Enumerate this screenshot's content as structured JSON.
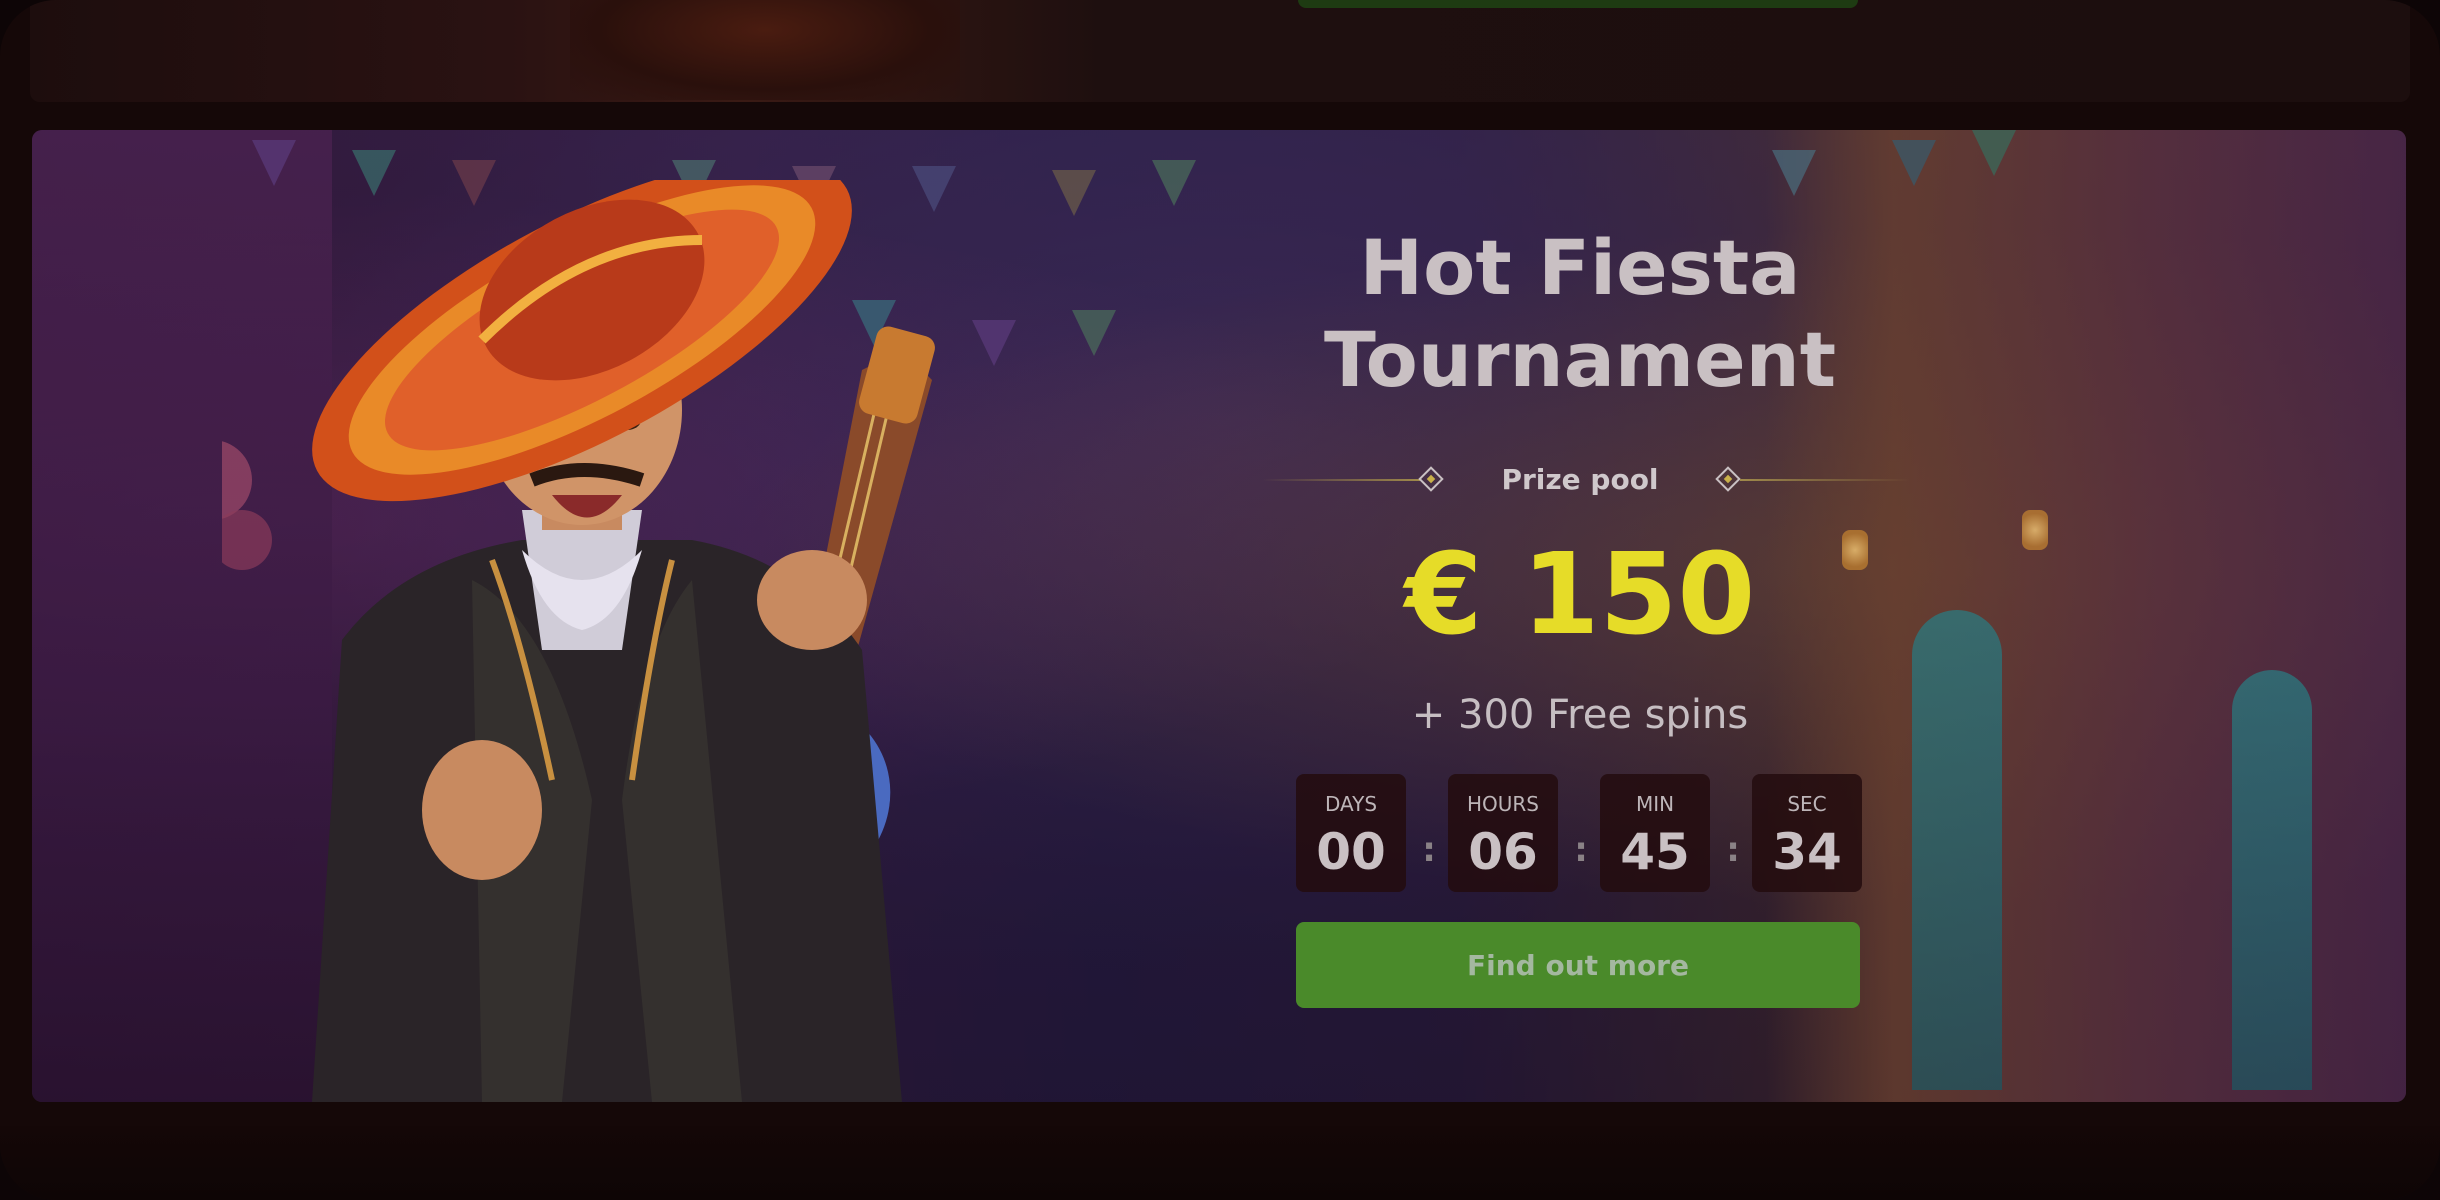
{
  "banner": {
    "title_line1": "Hot Fiesta",
    "title_line2": "Tournament",
    "prize_label": "Prize pool",
    "prize_amount": "€ 150",
    "free_spins": "+ 300 Free spins",
    "countdown": [
      {
        "label": "DAYS",
        "value": "00"
      },
      {
        "label": "HOURS",
        "value": "06"
      },
      {
        "label": "MIN",
        "value": "45"
      },
      {
        "label": "SEC",
        "value": "34"
      }
    ],
    "separator": ":",
    "cta_label": "Find out more"
  },
  "colors": {
    "accent_yellow": "#e6dc28",
    "cta_green": "#4a8a2a",
    "overlay": "#150808"
  },
  "icons": [
    "mariachi-character-illustration",
    "guitar-icon",
    "diamond-icon"
  ]
}
